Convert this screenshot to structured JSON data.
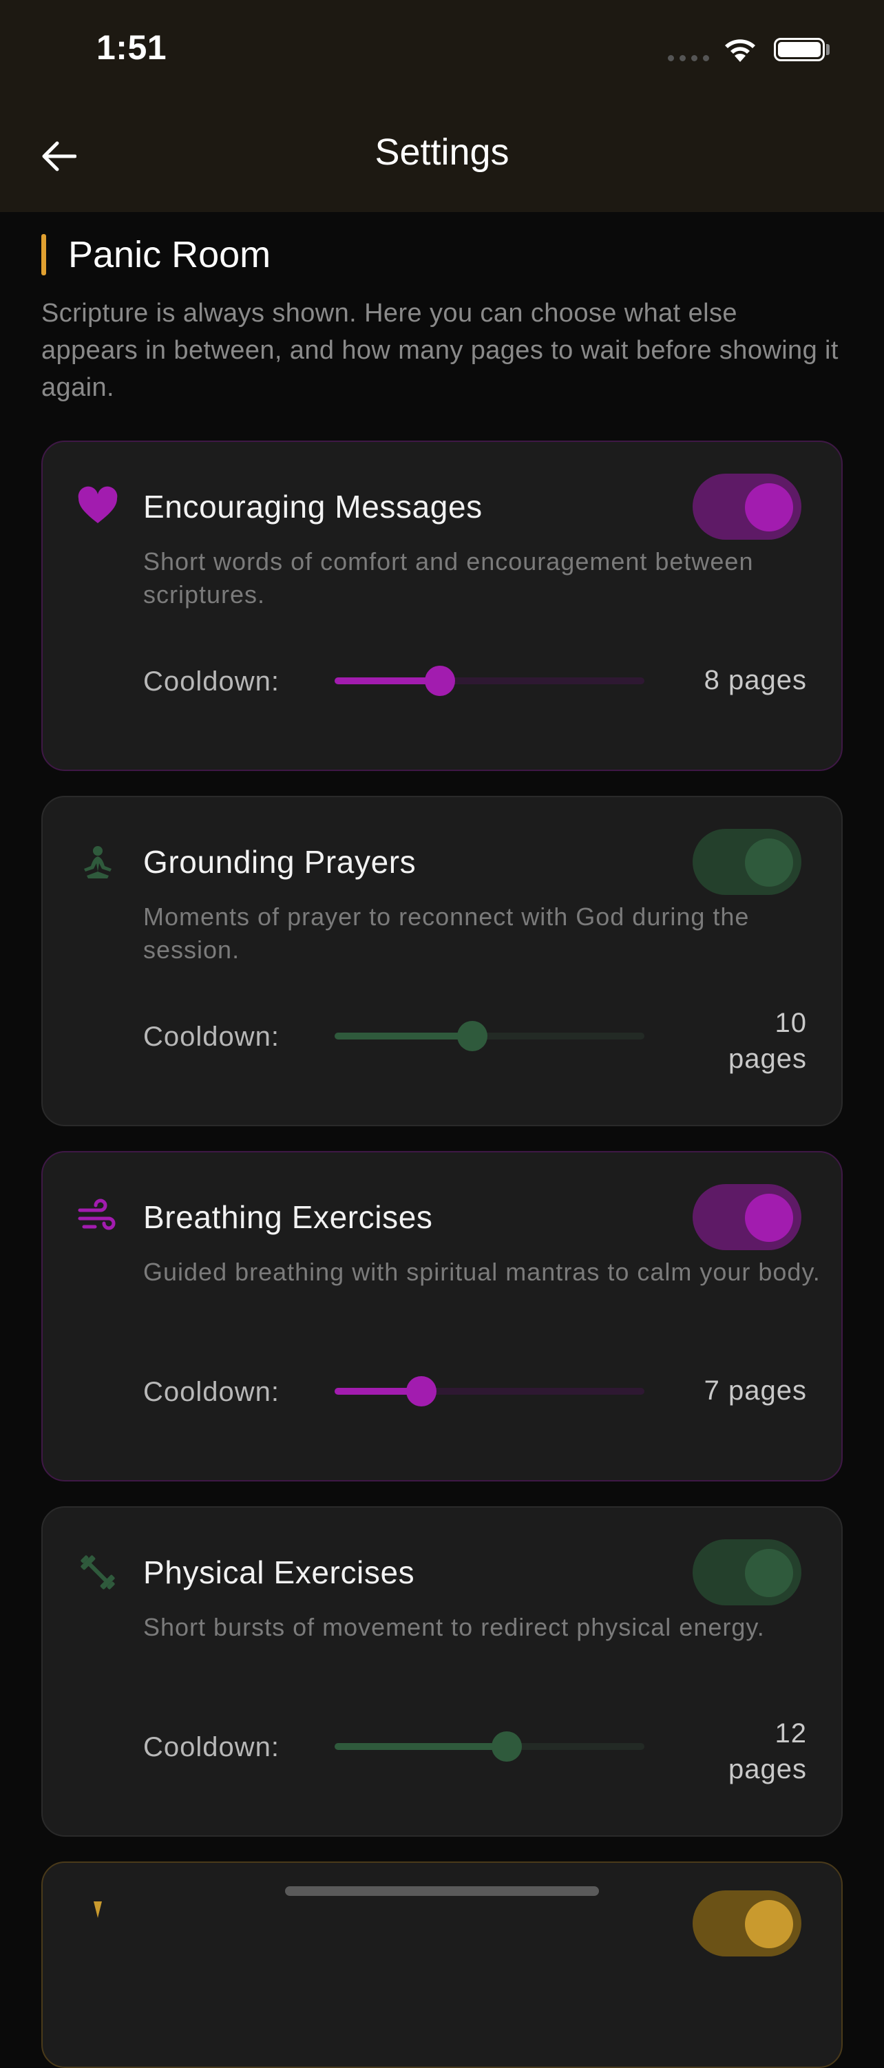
{
  "status": {
    "time": "1:51"
  },
  "appbar": {
    "title": "Settings"
  },
  "section": {
    "title": "Panic Room",
    "description": "Scripture is always shown. Here you can choose what else appears in between, and how many pages to wait before showing it again."
  },
  "colors": {
    "accent": "#e0a030",
    "purple": "#a21caf",
    "green": "#2f5a3c",
    "amber": "#c99a2e"
  },
  "cards": [
    {
      "icon": "heart-icon",
      "title": "Encouraging Messages",
      "description": "Short words of comfort and encouragement between scriptures.",
      "enabled": true,
      "cooldown_label": "Cooldown:",
      "cooldown_value": "8 pages",
      "slider_fraction": 0.34
    },
    {
      "icon": "prayer-icon",
      "title": "Grounding Prayers",
      "description": "Moments of prayer to reconnect with God during the session.",
      "enabled": true,
      "cooldown_label": "Cooldown:",
      "cooldown_value_line1": "10",
      "cooldown_value_line2": "pages",
      "slider_fraction": 0.445
    },
    {
      "icon": "wind-icon",
      "title": "Breathing Exercises",
      "description": "Guided breathing with spiritual mantras to calm your body.",
      "enabled": true,
      "cooldown_label": "Cooldown:",
      "cooldown_value": "7 pages",
      "slider_fraction": 0.28
    },
    {
      "icon": "dumbbell-icon",
      "title": "Physical Exercises",
      "description": "Short bursts of movement to redirect physical energy.",
      "enabled": true,
      "cooldown_label": "Cooldown:",
      "cooldown_value_line1": "12",
      "cooldown_value_line2": "pages",
      "slider_fraction": 0.555
    }
  ]
}
